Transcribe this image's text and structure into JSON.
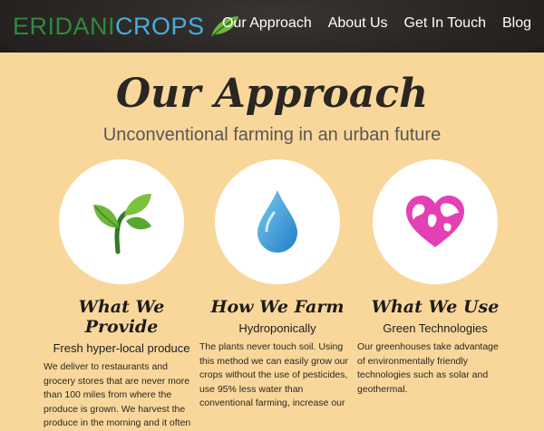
{
  "header": {
    "logo": {
      "part1": "ERIDANI",
      "part2": "CROPS"
    },
    "nav": [
      "Our Approach",
      "About Us",
      "Get In Touch",
      "Blog"
    ]
  },
  "hero": {
    "title": "Our Approach",
    "subtitle": "Unconventional farming in an urban future"
  },
  "columns": [
    {
      "icon": "sprout-icon",
      "heading": "What We Provide",
      "subheading": "Fresh hyper-local produce",
      "text": "We deliver to restaurants and grocery stores that are never more than 100 miles from where the produce is grown. We harvest the produce in the morning and it often"
    },
    {
      "icon": "water-drop-icon",
      "heading": "How We Farm",
      "subheading": "Hydroponically",
      "text": "The plants never touch soil. Using this method we can easily grow our crops without the use of pesticides, use 95% less water than conventional farming, increase our"
    },
    {
      "icon": "globe-heart-icon",
      "heading": "What We Use",
      "subheading": "Green Technologies",
      "text": "Our greenhouses take advantage of environmentally friendly technologies such as solar and geothermal."
    }
  ],
  "colors": {
    "background": "#f9d79b",
    "header": "#1e1c1b",
    "logo_green": "#2f8a3d",
    "logo_blue": "#44aee0",
    "drop_blue": "#3aa0de",
    "heart_pink": "#e43fb5"
  }
}
